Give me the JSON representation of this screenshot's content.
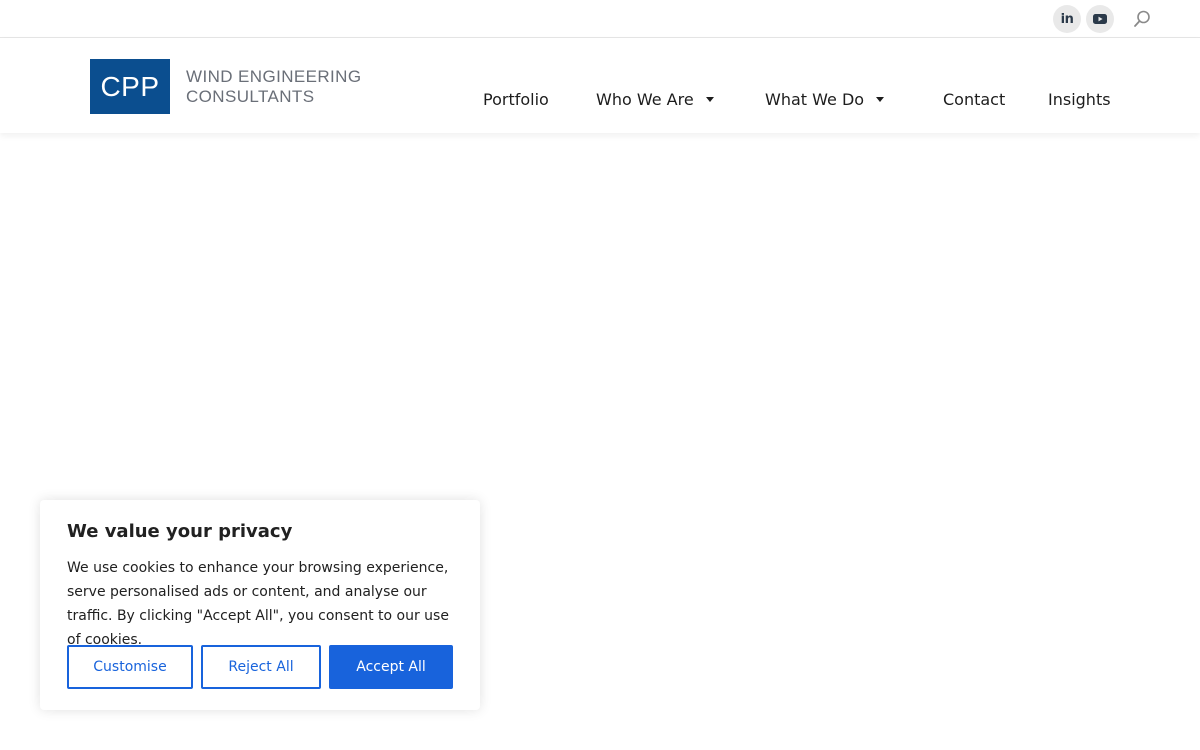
{
  "topbar": {
    "social": [
      {
        "name": "linkedin-icon",
        "glyph": "in"
      },
      {
        "name": "youtube-icon"
      }
    ],
    "search_icon": "search-icon"
  },
  "header": {
    "logo": {
      "mark": "CPP",
      "line1": "WIND ENGINEERING",
      "line2": "CONSULTANTS"
    },
    "nav": [
      {
        "label": "Portfolio",
        "has_dropdown": false
      },
      {
        "label": "Who We Are",
        "has_dropdown": true
      },
      {
        "label": "What We Do",
        "has_dropdown": true
      },
      {
        "label": "Contact",
        "has_dropdown": false
      },
      {
        "label": "Insights",
        "has_dropdown": false
      }
    ]
  },
  "cookie_banner": {
    "title": "We value your privacy",
    "text": "We use cookies to enhance your browsing experience, serve personalised ads or content, and analyse our traffic. By clicking \"Accept All\", you consent to our use of cookies.",
    "buttons": {
      "customise": "Customise",
      "reject": "Reject All",
      "accept": "Accept All"
    },
    "accent_color": "#1863dc"
  },
  "colors": {
    "logo_blue": "#0b4e8f",
    "accent": "#1863dc"
  }
}
